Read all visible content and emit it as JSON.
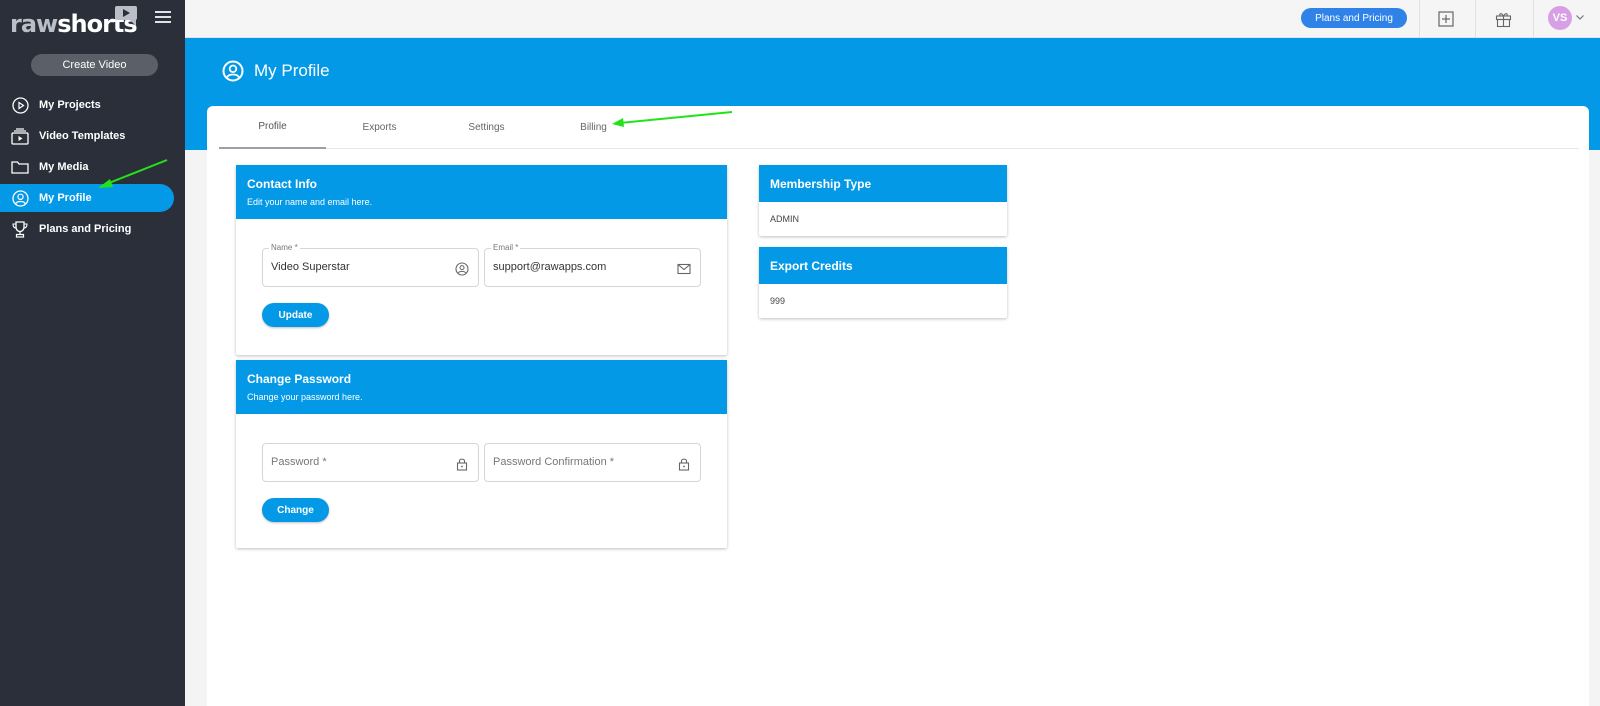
{
  "app": {
    "logo_raw": "raw",
    "logo_shorts": "shorts"
  },
  "sidebar": {
    "create_label": "Create Video",
    "items": [
      {
        "label": "My Projects",
        "icon": "play-circle-icon"
      },
      {
        "label": "Video Templates",
        "icon": "template-stack-icon"
      },
      {
        "label": "My Media",
        "icon": "folder-icon"
      },
      {
        "label": "My Profile",
        "icon": "user-circle-icon",
        "active": true
      },
      {
        "label": "Plans and Pricing",
        "icon": "trophy-icon"
      }
    ]
  },
  "topbar": {
    "plans_label": "Plans and Pricing",
    "add_icon": "add-square-icon",
    "gift_icon": "gift-icon",
    "avatar_initials": "VS"
  },
  "header": {
    "title": "My Profile",
    "icon": "user-circle-icon"
  },
  "tabs": [
    "Profile",
    "Exports",
    "Settings",
    "Billing"
  ],
  "contact": {
    "title": "Contact Info",
    "subtitle": "Edit your name and email here.",
    "name_label": "Name *",
    "name_value": "Video Superstar",
    "email_label": "Email *",
    "email_value": "support@rawapps.com",
    "button": "Update"
  },
  "password": {
    "title": "Change Password",
    "subtitle": "Change your password here.",
    "password_placeholder": "Password *",
    "confirm_placeholder": "Password Confirmation *",
    "button": "Change"
  },
  "membership": {
    "title": "Membership Type",
    "value": "ADMIN"
  },
  "credits": {
    "title": "Export Credits",
    "value": "999"
  },
  "colors": {
    "accent": "#0499e6",
    "sidebar": "#2a2f3a",
    "plans_button": "#2f83e8",
    "avatar": "#d7a0e4",
    "annotation_arrow": "#22e31a"
  }
}
